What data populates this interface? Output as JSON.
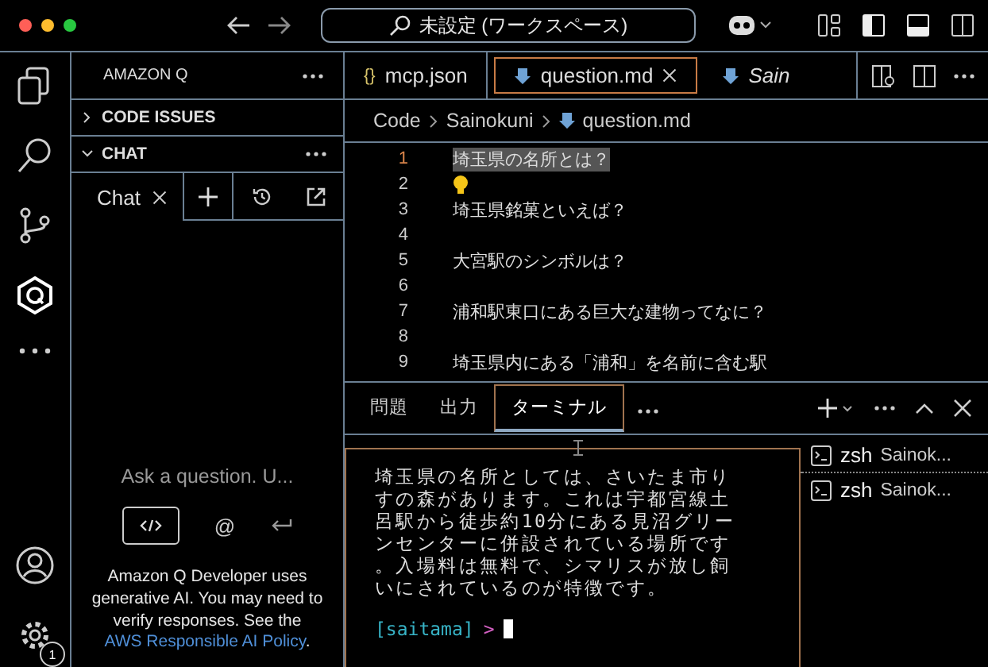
{
  "title_bar": {
    "search": "未設定 (ワークスペース)"
  },
  "activity_bar": {
    "items": [
      {
        "kind": "files"
      },
      {
        "kind": "search"
      },
      {
        "kind": "source"
      },
      {
        "kind": "amazonq"
      },
      {
        "kind": "more"
      }
    ],
    "settings_badge": "1"
  },
  "sidebar": {
    "title": "AMAZON Q",
    "sections": [
      {
        "label": "CODE ISSUES",
        "expanded": false
      },
      {
        "label": "CHAT",
        "expanded": true
      }
    ],
    "chat_tab": "Chat",
    "placeholder": "Ask a question. U...",
    "at_sign": "@",
    "disclaimer": "Amazon Q Developer uses generative AI. You may need to verify responses. See the",
    "link": "AWS Responsible AI Policy",
    "after_link": "."
  },
  "editor_tabs": [
    {
      "label": "mcp.json",
      "kind": "json",
      "icon_text": "{}",
      "selected": false,
      "italic": false
    },
    {
      "label": "question.md",
      "kind": "md",
      "selected": true,
      "italic": false
    },
    {
      "label": "Sain",
      "kind": "md",
      "selected": false,
      "italic": true
    }
  ],
  "breadcrumb": [
    "Code",
    "Sainokuni",
    "question.md"
  ],
  "editor_lines": [
    {
      "number": "1",
      "text": "埼玉県の名所とは？",
      "current": true,
      "bulb": false
    },
    {
      "number": "2",
      "current": false,
      "bulb": true
    },
    {
      "number": "3",
      "text": "埼玉県銘菓といえば？",
      "current": false,
      "bulb": false
    },
    {
      "number": "4",
      "current": false,
      "bulb": false
    },
    {
      "number": "5",
      "text": "大宮駅のシンボルは？",
      "current": false,
      "bulb": false
    },
    {
      "number": "6",
      "current": false,
      "bulb": false
    },
    {
      "number": "7",
      "text": "浦和駅東口にある巨大な建物ってなに？",
      "current": false,
      "bulb": false
    },
    {
      "number": "8",
      "current": false,
      "bulb": false
    },
    {
      "number": "9",
      "text": "埼玉県内にある「浦和」を名前に含む駅",
      "current": false,
      "bulb": false
    }
  ],
  "panel_tabs": [
    {
      "label": "問題",
      "selected": false
    },
    {
      "label": "出力",
      "selected": false
    },
    {
      "label": "ターミナル",
      "selected": true
    }
  ],
  "terminal": {
    "lines": [
      "埼玉県の名所としては、さいたま市り",
      "すの森があります。これは宇都宮線土",
      "呂駅から徒歩約10分にある見沼グリー",
      "ンセンターに併設されている場所です",
      "。入場料は無料で、シマリスが放し飼",
      "いにされているのが特徴です。"
    ],
    "prompt": "[saitama]",
    "prompt_arrow": ">"
  },
  "terminal_list": [
    {
      "shell": "zsh",
      "name": "Sainok...",
      "selected": true
    },
    {
      "shell": "zsh",
      "name": "Sainok...",
      "selected": false
    }
  ]
}
